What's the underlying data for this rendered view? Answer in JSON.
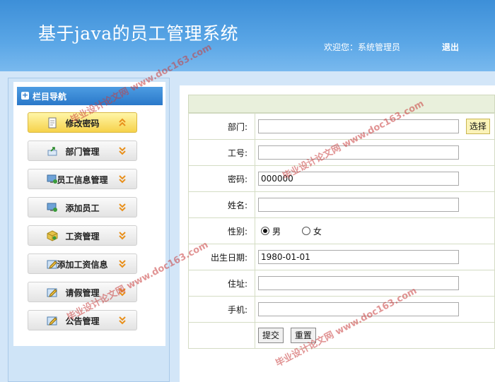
{
  "header": {
    "app_title": "基于java的员工管理系统",
    "welcome": "欢迎您：系统管理员",
    "logout": "退出"
  },
  "sidebar": {
    "title": "栏目导航",
    "items": [
      {
        "label": "修改密码",
        "icon": "notepad-icon",
        "active": true
      },
      {
        "label": "部门管理",
        "icon": "arrow-doc-icon",
        "active": false
      },
      {
        "label": "员工信息管理",
        "icon": "monitor-user-icon",
        "active": false
      },
      {
        "label": "添加员工",
        "icon": "monitor-user-icon",
        "active": false
      },
      {
        "label": "工资管理",
        "icon": "package-icon",
        "active": false
      },
      {
        "label": "添加工资信息",
        "icon": "edit-doc-icon",
        "active": false
      },
      {
        "label": "请假管理",
        "icon": "edit-doc-icon",
        "active": false
      },
      {
        "label": "公告管理",
        "icon": "edit-doc-icon",
        "active": false
      }
    ]
  },
  "form": {
    "fields": {
      "department": {
        "label": "部门:",
        "value": ""
      },
      "employee_no": {
        "label": "工号:",
        "value": ""
      },
      "password": {
        "label": "密码:",
        "value": "000000"
      },
      "name": {
        "label": "姓名:",
        "value": ""
      },
      "gender": {
        "label": "性别:",
        "options": [
          "男",
          "女"
        ],
        "selected": "男"
      },
      "birth_date": {
        "label": "出生日期:",
        "value": "1980-01-01"
      },
      "address": {
        "label": "住址:",
        "value": ""
      },
      "phone": {
        "label": "手机:",
        "value": ""
      }
    },
    "select_button": "选择",
    "submit_button": "提交",
    "reset_button": "重置"
  },
  "watermark": {
    "site": "毕业设计论文网",
    "url": "www.doc163.com"
  },
  "colors": {
    "header": "#4a9ae0",
    "nav_active": "#f6d24a",
    "chevron": "#e8901c",
    "watermark": "#c83c3c"
  }
}
